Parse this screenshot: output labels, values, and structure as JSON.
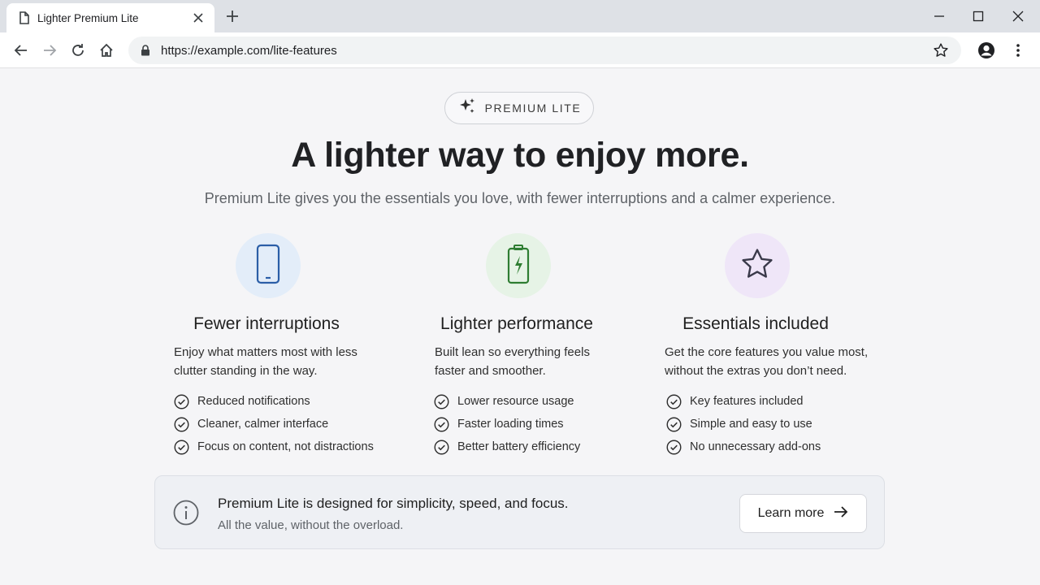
{
  "browser": {
    "tab_title": "Lighter Premium Lite",
    "url": "https://example.com/lite-features"
  },
  "hero": {
    "badge": "PREMIUM LITE",
    "headline": "A lighter way to enjoy more.",
    "subheadline": "Premium Lite gives you the essentials you love, with fewer interruptions and a calmer experience."
  },
  "features": [
    {
      "icon": "phone-icon",
      "icon_color": "#2b5ea7",
      "circle_color": "#e3edf9",
      "title": "Fewer interruptions",
      "description_line1": "Enjoy what matters most with less",
      "description_line2": "clutter standing in the way.",
      "items": [
        "Reduced notifications",
        "Cleaner, calmer interface",
        "Focus on content, not distractions"
      ]
    },
    {
      "icon": "battery-charging-icon",
      "icon_color": "#2e7d32",
      "circle_color": "#e6f3e6",
      "title": "Lighter performance",
      "description_line1": "Built lean so everything feels",
      "description_line2": "faster and smoother.",
      "items": [
        "Lower resource usage",
        "Faster loading times",
        "Better battery efficiency"
      ]
    },
    {
      "icon": "star-outline-icon",
      "icon_color": "#3a3a4a",
      "circle_color": "#efe6f8",
      "title": "Essentials included",
      "description_line1": "Get the core features you value most,",
      "description_line2": "without the extras you don’t need.",
      "items": [
        "Key features included",
        "Simple and easy to use",
        "No unnecessary add-ons"
      ]
    }
  ],
  "banner": {
    "title": "Premium Lite is designed for simplicity, speed, and focus.",
    "subtitle": "All the value, without the overload.",
    "button_label": "Learn more"
  }
}
